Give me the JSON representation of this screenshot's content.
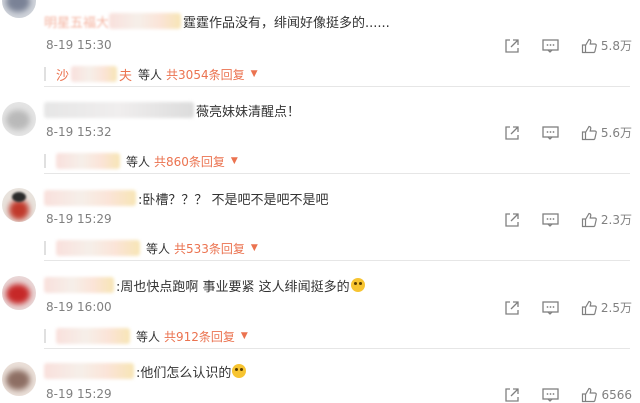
{
  "comments": [
    {
      "text_prefix": "明星五福大",
      "text": "霆霆作品没有，绯闻好像挺多的......",
      "time": "8-19 15:30",
      "likes": "5.8万",
      "reply": {
        "name_prefix": "沙",
        "name_suffix": "夫",
        "etc": "等人",
        "count": "共3054条回复"
      }
    },
    {
      "text": "薇亮妹妹清醒点！",
      "time": "8-19 15:32",
      "likes": "5.6万",
      "reply": {
        "etc": "等人",
        "count": "共860条回复"
      }
    },
    {
      "text": ":卧槽？？？ 不是吧不是吧不是吧",
      "time": "8-19 15:29",
      "likes": "2.3万",
      "reply": {
        "etc": "等人",
        "count": "共533条回复"
      }
    },
    {
      "text": ":周也快点跑啊 事业要紧 这人绯闻挺多的",
      "time": "8-19 16:00",
      "likes": "2.5万",
      "reply": {
        "etc": "等人",
        "count": "共912条回复"
      }
    },
    {
      "text": ":他们怎么认识的",
      "time": "8-19 15:29",
      "likes": "6566"
    }
  ],
  "icons": {
    "share": "share-icon",
    "comment": "comment-icon",
    "like": "thumbs-up-icon",
    "expand": "caret-down-icon"
  },
  "colors": {
    "accent": "#eb7350",
    "meta_text": "#808080",
    "divider": "#e6e6e6"
  }
}
